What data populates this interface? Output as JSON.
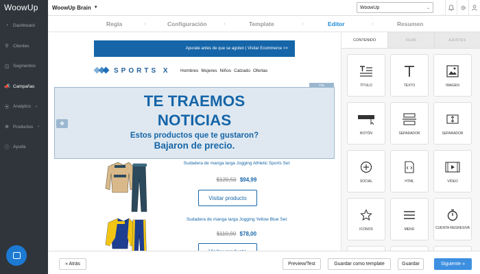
{
  "app": {
    "logo": "WoowUp",
    "brand": "WoowUp Brain",
    "account": "WoowUp"
  },
  "sidebar": {
    "items": [
      {
        "label": "Dashboard",
        "icon": "dashboard-icon"
      },
      {
        "label": "Clientes",
        "icon": "search-icon"
      },
      {
        "label": "Segmentos",
        "icon": "filter-icon"
      },
      {
        "label": "Campañas",
        "icon": "megaphone-icon",
        "active": true
      },
      {
        "label": "Analytics",
        "icon": "analytics-icon",
        "arrow": "›"
      },
      {
        "label": "Productos",
        "icon": "products-icon",
        "arrow": "›"
      },
      {
        "label": "Ayuda",
        "icon": "help-icon"
      }
    ]
  },
  "steps": [
    {
      "label": "Regla"
    },
    {
      "label": "Configuración"
    },
    {
      "label": "Template"
    },
    {
      "label": "Editor",
      "active": true
    },
    {
      "label": "Resumen"
    }
  ],
  "email": {
    "promo": "Apurate antes de que se agoten  |  Visitar Ecommerce  >>",
    "brand": "SPORTS X",
    "nav": [
      "Hombres",
      "Mujeres",
      "Niños",
      "Calzado",
      "Ofertas"
    ],
    "row_tag": "Fila",
    "hero_line1": "TE TRAEMOS",
    "hero_line2": "NOTICIAS",
    "hero_sub1": "Estos productos que te gustaron?",
    "hero_sub2": "Bajaron de precio.",
    "products": [
      {
        "name": "Sudadera de manga larga Jogging Athletic Sports Set",
        "old_price": "$120,50",
        "new_price": "$94,99",
        "cta": "Visitar producto"
      },
      {
        "name": "Sudadera de manga larga Jogging Yellow Blue Set",
        "old_price": "$110,90",
        "new_price": "$78,00",
        "cta": "Visitar producto"
      }
    ]
  },
  "panel": {
    "tabs": [
      "CONTENIDO",
      "FILAS",
      "AJUSTES"
    ],
    "blocks": [
      {
        "label": "TÍTULO",
        "icon": "title-icon"
      },
      {
        "label": "TEXTO",
        "icon": "text-icon"
      },
      {
        "label": "IMAGEN",
        "icon": "image-icon"
      },
      {
        "label": "BOTÓN",
        "icon": "button-icon"
      },
      {
        "label": "SEPARADOR",
        "icon": "separator-icon"
      },
      {
        "label": "SEPARADOR",
        "icon": "spacer-icon"
      },
      {
        "label": "SOCIAL",
        "icon": "social-icon"
      },
      {
        "label": "HTML",
        "icon": "html-icon"
      },
      {
        "label": "VÍDEO",
        "icon": "video-icon"
      },
      {
        "label": "ICONOS",
        "icon": "star-icon"
      },
      {
        "label": "MENÚ",
        "icon": "menu-icon"
      },
      {
        "label": "CUENTA REGRESIVA",
        "icon": "timer-icon"
      }
    ]
  },
  "footer": {
    "back": "« Atrás",
    "preview": "Preview/Test",
    "save_template": "Guardar como template",
    "save": "Guardar",
    "next": "Siguiente »"
  },
  "colors": {
    "sidebar": "#2f353b",
    "accent": "#1565a8",
    "active_step": "#1d8ad8",
    "primary_button": "#3d8fe0"
  }
}
